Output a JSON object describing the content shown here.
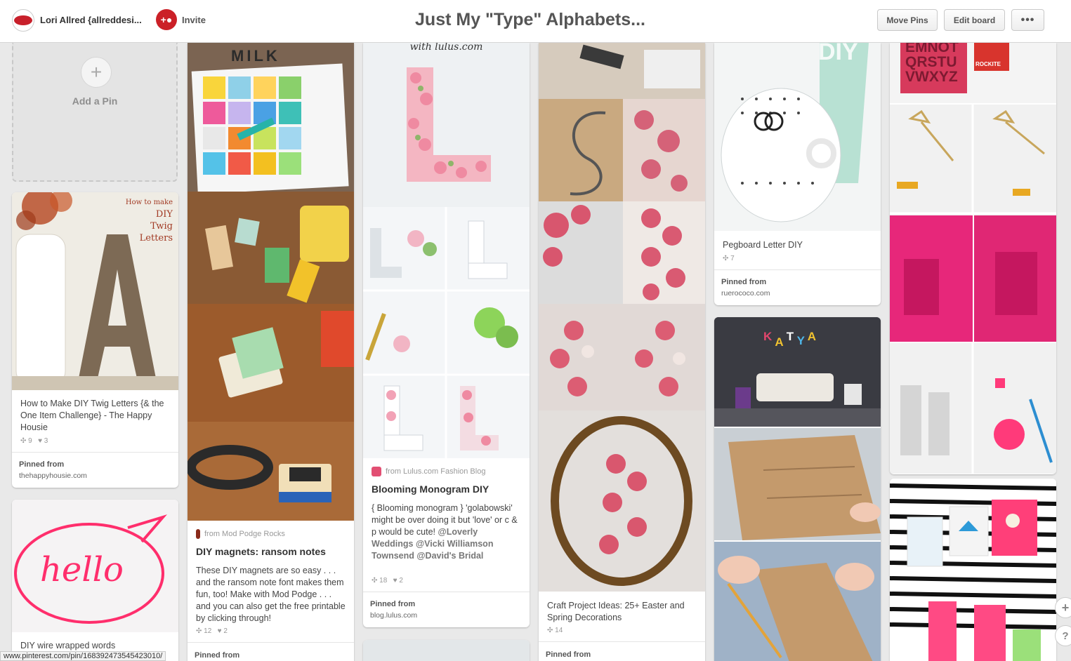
{
  "header": {
    "owner_name": "Lori Allred {allreddesi...",
    "invite_label": "Invite",
    "board_title": "Just My \"Type\" Alphabets...",
    "move_pins_label": "Move Pins",
    "edit_board_label": "Edit board",
    "more_label": "•••"
  },
  "add_pin": {
    "label": "Add a Pin",
    "plus": "+"
  },
  "pins": {
    "twig": {
      "overlay": [
        "How to make",
        "DIY",
        "Twig",
        "Letters"
      ],
      "description": "How to Make DIY Twig Letters {& the One Item Challenge} - The Happy Housie",
      "repins": "9",
      "likes": "3",
      "pinned_label": "Pinned from",
      "pinned_source": "thehappyhousie.com"
    },
    "hello": {
      "description": "DIY wire wrapped words",
      "overlay": "hello"
    },
    "magnets": {
      "from": "from Mod Podge Rocks",
      "title": "DIY magnets: ransom notes",
      "description": "These DIY magnets are so easy . . . and the ransom note font makes them fun, too! Make with Mod Podge . . . and you can also get the free printable by clicking through!",
      "repins": "12",
      "likes": "2",
      "pinned_label": "Pinned from",
      "milk": "MILK"
    },
    "monogram": {
      "overlay": "with lulus.com",
      "from": "from Lulus.com Fashion Blog",
      "title": "Blooming Monogram DIY",
      "description": "{ Blooming monogram } 'golabowski' might be over doing it but 'love' or c & p would be cute!",
      "mentions": "@Loverly Weddings @Vicki Williamson Townsend @David's Bridal",
      "repins": "18",
      "likes": "2",
      "pinned_label": "Pinned from",
      "pinned_source": "blog.lulus.com"
    },
    "craft": {
      "description": "Craft Project Ideas: 25+ Easter and Spring Decorations",
      "repins": "14",
      "pinned_label": "Pinned from"
    },
    "pegboard": {
      "overlay": "DIY",
      "description": "Pegboard Letter DIY",
      "repins": "7",
      "pinned_label": "Pinned from",
      "pinned_source": "ruerococo.com"
    },
    "katya": {
      "overlay": [
        "K",
        "A",
        "T",
        "Y",
        "A"
      ]
    },
    "stamps": {
      "overlay": [
        "EMNOT",
        "QRSTU",
        "VWXYZ"
      ],
      "brand": "ROCKITE"
    }
  },
  "side": {
    "add_label": "+",
    "help_label": "?"
  },
  "status_url": "www.pinterest.com/pin/168392473545423010/",
  "colors": {
    "pinterest_red": "#cb2027",
    "background": "#e9e9e9"
  }
}
